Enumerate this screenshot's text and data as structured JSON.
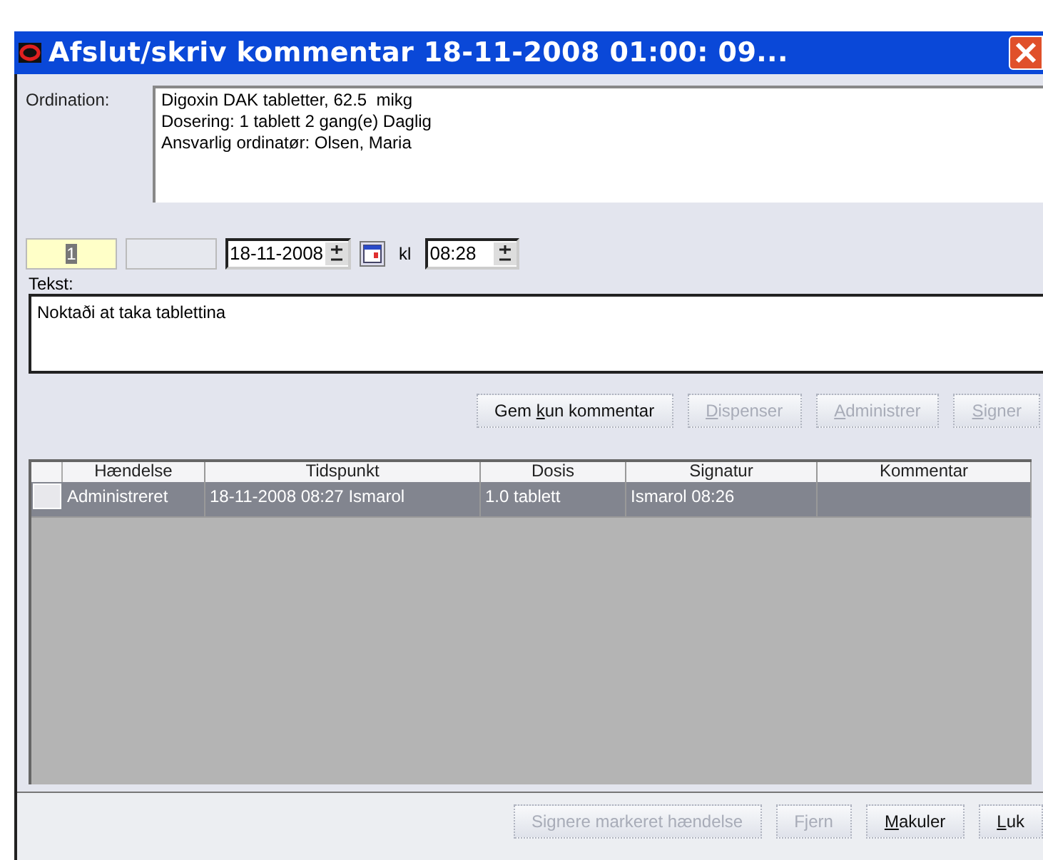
{
  "window": {
    "title": "Afslut/skriv kommentar 18-11-2008 01:00: 09..."
  },
  "ordination": {
    "label": "Ordination:",
    "lines": [
      "Digoxin DAK tabletter, 62.5  mikg",
      "Dosering: 1 tablett 2 gang(e) Daglig",
      "Ansvarlig ordinatør: Olsen, Maria"
    ]
  },
  "entry": {
    "count": "1",
    "date": "18-11-2008",
    "time_label": "kl",
    "time": "08:28"
  },
  "text": {
    "label": "Tekst:",
    "value": "Noktaði at taka tablettina"
  },
  "action_buttons": [
    {
      "before": "Gem ",
      "underlined": "k",
      "rest": "un kommentar",
      "disabled": false
    },
    {
      "underlined": "D",
      "rest": "ispenser",
      "disabled": true
    },
    {
      "underlined": "A",
      "rest": "dministrer",
      "disabled": true
    },
    {
      "underlined": "S",
      "rest": "igner",
      "disabled": true
    }
  ],
  "table": {
    "columns": [
      "Hændelse",
      "Tidspunkt",
      "Dosis",
      "Signatur",
      "Kommentar"
    ],
    "rows": [
      {
        "selected": true,
        "cells": [
          "Administreret",
          "18-11-2008 08:27 Ismarol",
          "1.0 tablett",
          "Ismarol 08:26"
        ]
      }
    ]
  },
  "bottom_buttons": [
    {
      "rest": "Signere markeret hændelse",
      "disabled": true
    },
    {
      "rest": "Fjern",
      "disabled": true
    },
    {
      "underlined": "M",
      "rest": "akuler",
      "disabled": false
    },
    {
      "underlined": "L",
      "rest": "uk",
      "disabled": false
    }
  ]
}
